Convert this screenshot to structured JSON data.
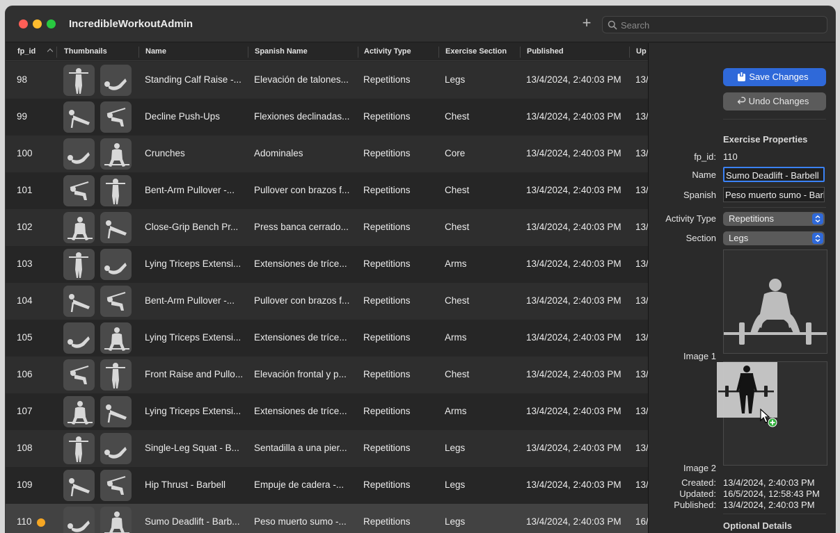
{
  "app": {
    "title": "IncredibleWorkoutAdmin"
  },
  "toolbar": {
    "add_label": "+",
    "search_placeholder": "Search"
  },
  "table": {
    "columns": [
      "fp_id",
      "Thumbnails",
      "Name",
      "Spanish Name",
      "Activity Type",
      "Exercise Section",
      "Published",
      "Up"
    ],
    "rows": [
      {
        "fp_id": "98",
        "name": "Standing Calf Raise -...",
        "spanish": "Elevación de talones...",
        "activity": "Repetitions",
        "section": "Legs",
        "published": "13/4/2024, 2:40:03 PM",
        "updated": "13/"
      },
      {
        "fp_id": "99",
        "name": "Decline Push-Ups",
        "spanish": "Flexiones declinadas...",
        "activity": "Repetitions",
        "section": "Chest",
        "published": "13/4/2024, 2:40:03 PM",
        "updated": "13/"
      },
      {
        "fp_id": "100",
        "name": "Crunches",
        "spanish": "Adominales",
        "activity": "Repetitions",
        "section": "Core",
        "published": "13/4/2024, 2:40:03 PM",
        "updated": "13/"
      },
      {
        "fp_id": "101",
        "name": "Bent-Arm Pullover -...",
        "spanish": "Pullover con brazos f...",
        "activity": "Repetitions",
        "section": "Chest",
        "published": "13/4/2024, 2:40:03 PM",
        "updated": "13/"
      },
      {
        "fp_id": "102",
        "name": "Close-Grip Bench Pr...",
        "spanish": "Press banca cerrado...",
        "activity": "Repetitions",
        "section": "Chest",
        "published": "13/4/2024, 2:40:03 PM",
        "updated": "13/"
      },
      {
        "fp_id": "103",
        "name": "Lying Triceps Extensi...",
        "spanish": "Extensiones de tríce...",
        "activity": "Repetitions",
        "section": "Arms",
        "published": "13/4/2024, 2:40:03 PM",
        "updated": "13/"
      },
      {
        "fp_id": "104",
        "name": "Bent-Arm Pullover -...",
        "spanish": "Pullover con brazos f...",
        "activity": "Repetitions",
        "section": "Chest",
        "published": "13/4/2024, 2:40:03 PM",
        "updated": "13/"
      },
      {
        "fp_id": "105",
        "name": "Lying Triceps Extensi...",
        "spanish": "Extensiones de tríce...",
        "activity": "Repetitions",
        "section": "Arms",
        "published": "13/4/2024, 2:40:03 PM",
        "updated": "13/"
      },
      {
        "fp_id": "106",
        "name": "Front Raise and Pullo...",
        "spanish": "Elevación frontal y p...",
        "activity": "Repetitions",
        "section": "Chest",
        "published": "13/4/2024, 2:40:03 PM",
        "updated": "13/"
      },
      {
        "fp_id": "107",
        "name": "Lying Triceps Extensi...",
        "spanish": "Extensiones de tríce...",
        "activity": "Repetitions",
        "section": "Arms",
        "published": "13/4/2024, 2:40:03 PM",
        "updated": "13/"
      },
      {
        "fp_id": "108",
        "name": "Single-Leg Squat - B...",
        "spanish": "Sentadilla a una pier...",
        "activity": "Repetitions",
        "section": "Legs",
        "published": "13/4/2024, 2:40:03 PM",
        "updated": "13/"
      },
      {
        "fp_id": "109",
        "name": "Hip Thrust - Barbell",
        "spanish": "Empuje de cadera -...",
        "activity": "Repetitions",
        "section": "Legs",
        "published": "13/4/2024, 2:40:03 PM",
        "updated": "13/"
      },
      {
        "fp_id": "110",
        "name": "Sumo Deadlift - Barb...",
        "spanish": "Peso muerto sumo -...",
        "activity": "Repetitions",
        "section": "Legs",
        "published": "13/4/2024, 2:40:03 PM",
        "updated": "16/"
      }
    ]
  },
  "detail": {
    "save_label": "Save Changes",
    "undo_label": "Undo Changes",
    "section_title": "Exercise Properties",
    "fp_id_label": "fp_id:",
    "fp_id_value": "110",
    "name_label": "Name",
    "name_value": "Sumo Deadlift - Barbell",
    "spanish_label": "Spanish",
    "spanish_value": "Peso muerto sumo - Barbell",
    "activity_label": "Activity Type",
    "activity_value": "Repetitions",
    "section_label": "Section",
    "section_value": "Legs",
    "image1_label": "Image 1",
    "image2_label": "Image 2",
    "created_label": "Created:",
    "created_value": "13/4/2024, 2:40:03 PM",
    "updated_label": "Updated:",
    "updated_value": "16/5/2024, 12:58:43 PM",
    "published_label": "Published:",
    "published_value": "13/4/2024, 2:40:03 PM",
    "optional_title": "Optional Details"
  },
  "colors": {
    "accent": "#2f69d9",
    "modified_dot": "#f5a623"
  }
}
